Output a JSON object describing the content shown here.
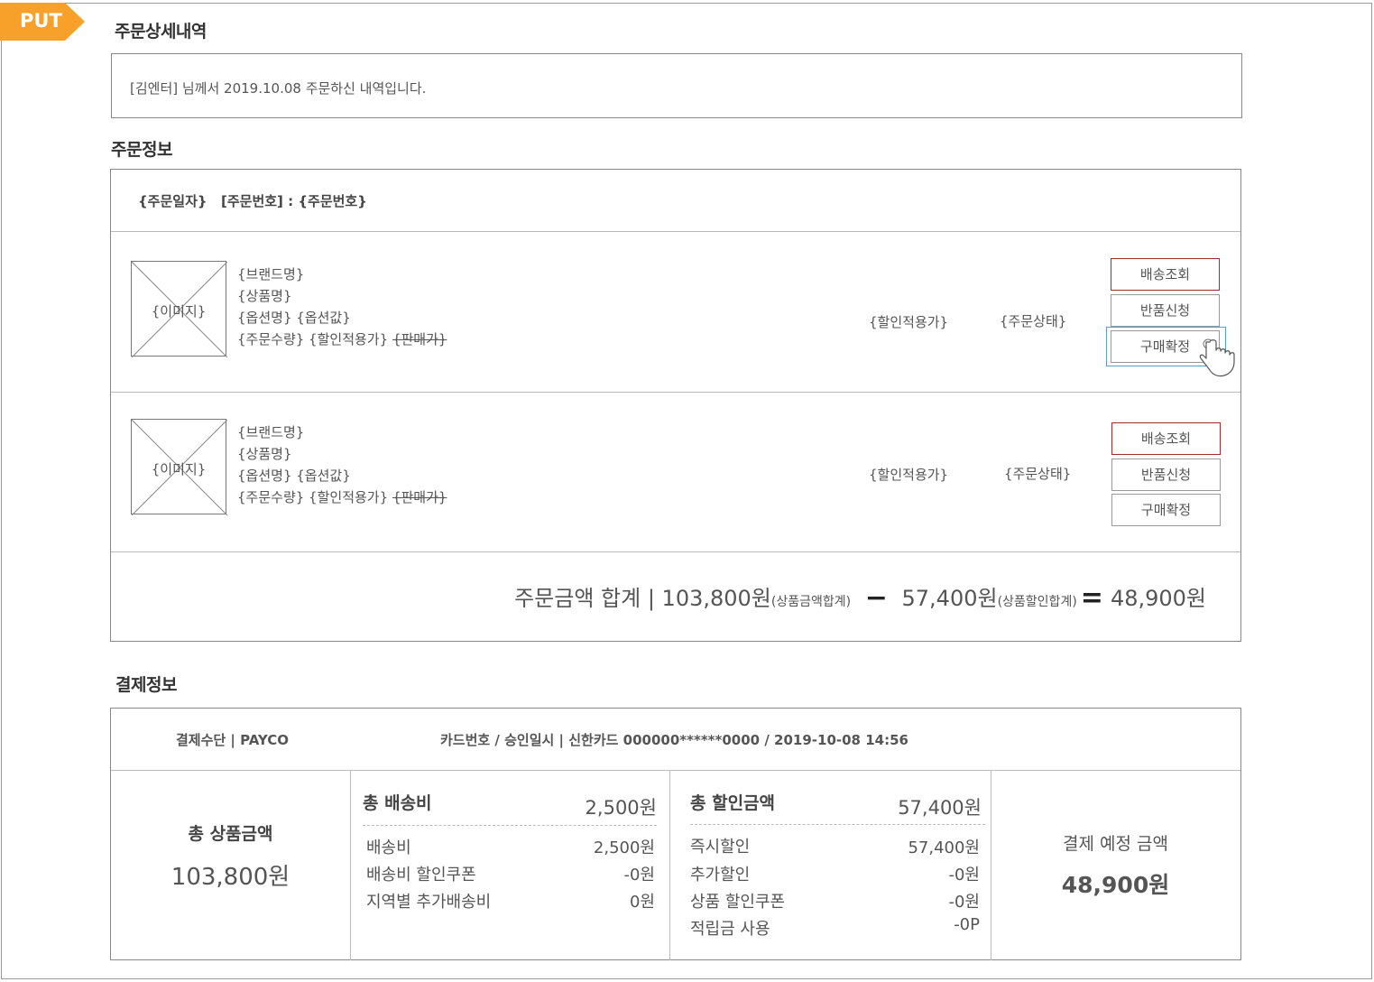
{
  "badge": "PUT",
  "page_title": "주문상세내역",
  "notice": "[김엔터] 님께서 2019.10.08 주문하신 내역입니다.",
  "order_info": {
    "title": "주문정보",
    "header_date": "{주문일자}",
    "header_number": "[주문번호] : {주문번호}",
    "items": [
      {
        "image": "{이미지}",
        "brand": "{브랜드명}",
        "product": "{상품명}",
        "option": "{옵션명} {옵션값}",
        "qty_price": "{주문수량} {할인적용가}",
        "list_price": "{판매가}",
        "discount_price": "{할인적용가}",
        "status": "{주문상태}",
        "buttons": [
          "배송조회",
          "반품신청",
          "구매확정"
        ]
      },
      {
        "image": "{이미지}",
        "brand": "{브랜드명}",
        "product": "{상품명}",
        "option": "{옵션명} {옵션값}",
        "qty_price": "{주문수량} {할인적용가}",
        "list_price": "{판매가}",
        "discount_price": "{할인적용가}",
        "status": "{주문상태}",
        "buttons": [
          "배송조회",
          "반품신청",
          "구매확정"
        ]
      }
    ],
    "summary": {
      "label": "주문금액 합계 | 103,800원",
      "label_note": "(상품금액합계)",
      "minus_op": "−",
      "discount": "57,400원",
      "discount_note": "(상품할인합계)",
      "equals_op": "=",
      "total": "48,900원"
    }
  },
  "payment_info": {
    "title": "결제정보",
    "method": "결제수단 | PAYCO",
    "card": "카드번호 / 승인일시 |  신한카드 000000******0000 / 2019-10-08 14:56",
    "total_product": {
      "label": "총 상품금액",
      "amount": "103,800원"
    },
    "shipping": {
      "label": "총 배송비",
      "amount": "2,500원",
      "lines": [
        {
          "name": "배송비",
          "value": "2,500원"
        },
        {
          "name": "배송비 할인쿠폰",
          "value": "-0원"
        },
        {
          "name": "지역별 추가배송비",
          "value": "0원"
        }
      ]
    },
    "discount": {
      "label": "총 할인금액",
      "amount": "57,400원",
      "lines": [
        {
          "name": "즉시할인",
          "value": "57,400원"
        },
        {
          "name": "추가할인",
          "value": "-0원"
        },
        {
          "name": "상품 할인쿠폰",
          "value": "-0원"
        },
        {
          "name": "적립금 사용",
          "value": "-0P"
        }
      ]
    },
    "final": {
      "label": "결제 예정 금액",
      "amount": "48,900원"
    }
  },
  "colors": {
    "badge": "#f7a12a",
    "tracking_border": "#a22a2a",
    "focus": "#5aa0cc"
  },
  "icons": [
    "hand-pointer-icon"
  ]
}
